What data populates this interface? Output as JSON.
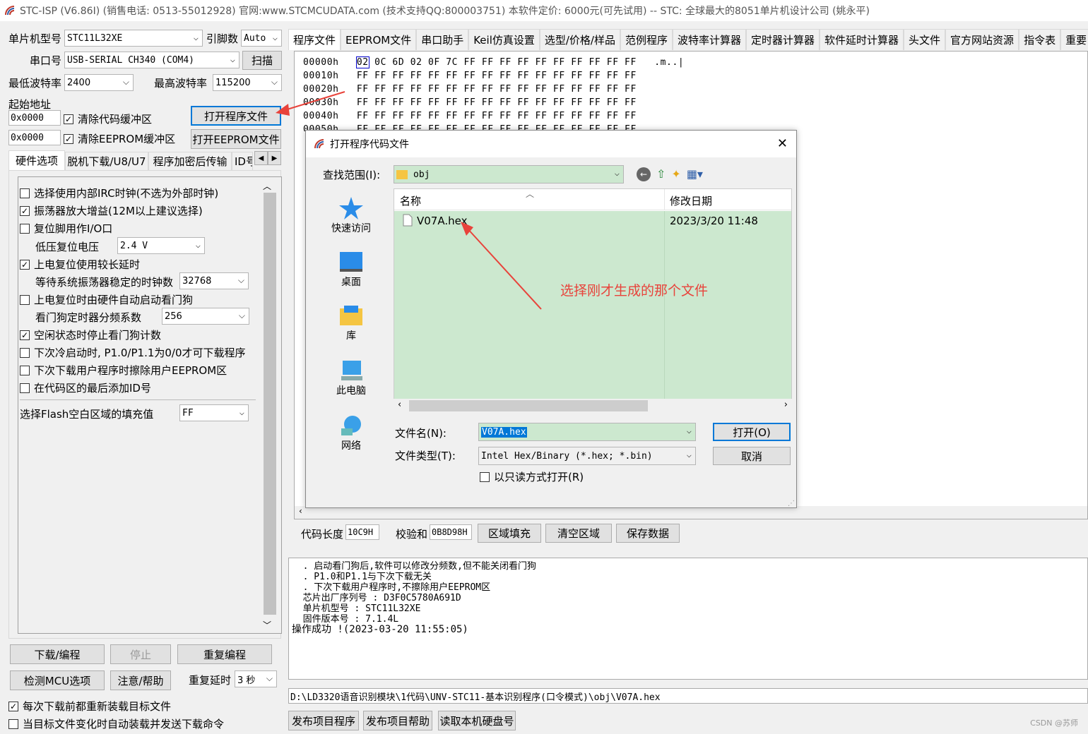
{
  "window": {
    "title": "STC-ISP (V6.86I) (销售电话: 0513-55012928) 官网:www.STCMCUDATA.com  (技术支持QQ:800003751) 本软件定价: 6000元(可先试用) -- STC: 全球最大的8051单片机设计公司 (姚永平)"
  },
  "left": {
    "mcu_type_label": "单片机型号",
    "mcu_type_value": "STC11L32XE",
    "pins_label": "引脚数",
    "pins_value": "Auto",
    "port_label": "串口号",
    "port_value": "USB-SERIAL CH340 (COM4)",
    "scan_button": "扫描",
    "min_baud_label": "最低波特率",
    "min_baud_value": "2400",
    "max_baud_label": "最高波特率",
    "max_baud_value": "115200",
    "start_addr_label": "起始地址",
    "addr1": "0x0000",
    "clear_code_label": "清除代码缓冲区",
    "open_program_button": "打开程序文件",
    "addr2": "0x0000",
    "clear_eeprom_label": "清除EEPROM缓冲区",
    "open_eeprom_button": "打开EEPROM文件",
    "tabs": [
      "硬件选项",
      "脱机下载/U8/U7",
      "程序加密后传输",
      "ID号"
    ],
    "options": [
      {
        "label": "选择使用内部IRC时钟(不选为外部时钟)",
        "checked": false
      },
      {
        "label": "振荡器放大增益(12M以上建议选择)",
        "checked": true
      },
      {
        "label": "复位脚用作I/O口",
        "checked": false
      }
    ],
    "low_voltage_label": "低压复位电压",
    "low_voltage_value": "2.4 V",
    "option_power": {
      "label": "上电复位使用较长延时",
      "checked": true
    },
    "wait_clock_label": "等待系统振荡器稳定的时钟数",
    "wait_clock_value": "32768",
    "option_watchdog": {
      "label": "上电复位时由硬件自动启动看门狗",
      "checked": false
    },
    "wdt_div_label": "看门狗定时器分频系数",
    "wdt_div_value": "256",
    "options2": [
      {
        "label": "空闲状态时停止看门狗计数",
        "checked": true
      },
      {
        "label": "下次冷启动时, P1.0/P1.1为0/0才可下载程序",
        "checked": false
      },
      {
        "label": "下次下载用户程序时擦除用户EEPROM区",
        "checked": false
      },
      {
        "label": "在代码区的最后添加ID号",
        "checked": false
      }
    ],
    "fill_label": "选择Flash空白区域的填充值",
    "fill_value": "FF",
    "download_button": "下载/编程",
    "stop_button": "停止",
    "reprogram_button": "重复编程",
    "detect_button": "检测MCU选项",
    "help_button": "注意/帮助",
    "repeat_delay_label": "重复延时",
    "repeat_delay_value": "3 秒",
    "reload_label": "每次下载前都重新装载目标文件",
    "reload_checked": true,
    "auto_label": "当目标文件变化时自动装载并发送下载命令",
    "auto_checked": false
  },
  "top_tabs": [
    "程序文件",
    "EEPROM文件",
    "串口助手",
    "Keil仿真设置",
    "选型/价格/样品",
    "范例程序",
    "波特率计算器",
    "定时器计算器",
    "软件延时计算器",
    "头文件",
    "官方网站资源",
    "指令表",
    "重要"
  ],
  "hex": {
    "rows": [
      {
        "addr": "00000h",
        "first": "02",
        "bytes": "0C 6D 02 0F 7C FF FF FF FF FF FF FF FF FF FF",
        "ascii": ".m..|"
      },
      {
        "addr": "00010h",
        "bytes": "FF FF FF FF FF FF FF FF FF FF FF FF FF FF FF FF"
      },
      {
        "addr": "00020h",
        "bytes": "FF FF FF FF FF FF FF FF FF FF FF FF FF FF FF FF"
      },
      {
        "addr": "00030h",
        "bytes": "FF FF FF FF FF FF FF FF FF FF FF FF FF FF FF FF"
      },
      {
        "addr": "00040h",
        "bytes": "FF FF FF FF FF FF FF FF FF FF FF FF FF FF FF FF"
      },
      {
        "addr": "00050h",
        "bytes": "FF FF FF FF FF FF FF FF FF FF FF FF FF FF FF FF"
      }
    ]
  },
  "bottom_bar": {
    "code_len_label": "代码长度",
    "code_len_value": "10C9H",
    "checksum_label": "校验和",
    "checksum_value": "0B8D98H",
    "fill_button": "区域填充",
    "clear_button": "清空区域",
    "save_button": "保存数据"
  },
  "log": [
    "  . 启动看门狗后,软件可以修改分频数,但不能关闭看门狗",
    "  . P1.0和P1.1与下次下载无关",
    "  . 下次下载用户程序时,不擦除用户EEPROM区",
    "",
    "  芯片出厂序列号 : D3F0C5780A691D",
    "  单片机型号 : STC11L32XE",
    "  固件版本号 : 7.1.4L",
    "",
    "",
    "操作成功 !(2023-03-20 11:55:05)"
  ],
  "path": "D:\\LD3320语音识别模块\\1代码\\UNV-STC11-基本识别程序(口令模式)\\obj\\V07A.hex",
  "footer_buttons": [
    "发布项目程序",
    "发布项目帮助",
    "读取本机硬盘号"
  ],
  "dialog": {
    "title": "打开程序代码文件",
    "look_in_label": "查找范围(I):",
    "look_in_value": "obj",
    "places": [
      "快速访问",
      "桌面",
      "库",
      "此电脑",
      "网络"
    ],
    "col_name": "名称",
    "col_date": "修改日期",
    "file_name": "V07A.hex",
    "file_date": "2023/3/20 11:48",
    "annotation": "选择刚才生成的那个文件",
    "filename_label": "文件名(N):",
    "filename_value": "V07A.hex",
    "filetype_label": "文件类型(T):",
    "filetype_value": "Intel Hex/Binary (*.hex; *.bin)",
    "readonly_label": "以只读方式打开(R)",
    "open_button": "打开(O)",
    "cancel_button": "取消"
  },
  "watermark": "CSDN @苏师",
  "colors": {
    "accent": "#0078d7",
    "list_bg": "#cce8cf",
    "annotation": "#e8433b",
    "arrow": "#e8433b"
  }
}
